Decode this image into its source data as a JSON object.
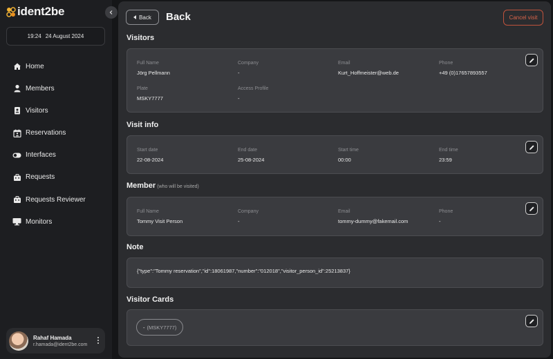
{
  "app": {
    "logo_text": "ident2be"
  },
  "sidebar": {
    "datetime": {
      "time": "19:24",
      "date": "24 August 2024"
    },
    "items": [
      {
        "label": "Home",
        "icon": "home-icon"
      },
      {
        "label": "Members",
        "icon": "person-icon"
      },
      {
        "label": "Visitors",
        "icon": "badge-icon"
      },
      {
        "label": "Reservations",
        "icon": "calendar-person-icon"
      },
      {
        "label": "Interfaces",
        "icon": "toggle-icon"
      },
      {
        "label": "Requests",
        "icon": "briefcase-icon"
      },
      {
        "label": "Requests Reviewer",
        "icon": "briefcase-icon"
      },
      {
        "label": "Monitors",
        "icon": "monitor-icon"
      }
    ],
    "user": {
      "name": "Rahaf Hamada",
      "email": "r.hamada@ident2be.com"
    }
  },
  "header": {
    "back_label": "Back",
    "title": "Back",
    "cancel_label": "Cancel visit"
  },
  "visitors": {
    "title": "Visitors",
    "fields": {
      "full_name": {
        "label": "Full Name",
        "value": "Jörg Pellmann"
      },
      "company": {
        "label": "Company",
        "value": "-"
      },
      "email": {
        "label": "Email",
        "value": "Kurt_Hoffmeister@web.de"
      },
      "phone": {
        "label": "Phone",
        "value": "+49 (0)17657893557"
      },
      "plate": {
        "label": "Plate",
        "value": "MSKY7777"
      },
      "access_profile": {
        "label": "Access Profile",
        "value": "-"
      }
    }
  },
  "visit_info": {
    "title": "Visit info",
    "fields": {
      "start_date": {
        "label": "Start date",
        "value": "22-08-2024"
      },
      "end_date": {
        "label": "End date",
        "value": "25-08-2024"
      },
      "start_time": {
        "label": "Start time",
        "value": "00:00"
      },
      "end_time": {
        "label": "End time",
        "value": "23:59"
      }
    }
  },
  "member": {
    "title": "Member",
    "subtitle": "(who will be visited)",
    "fields": {
      "full_name": {
        "label": "Full Name",
        "value": "Tommy Visit Person"
      },
      "company": {
        "label": "Company",
        "value": "-"
      },
      "email": {
        "label": "Email",
        "value": "tommy-dummy@fakemail.com"
      },
      "phone": {
        "label": "Phone",
        "value": "-"
      }
    }
  },
  "note": {
    "title": "Note",
    "text": "{\"type\":\"Tommy reservation\",\"id\":18061987,\"number\":\"012018\",\"visitor_person_id\":25213837}"
  },
  "visitor_cards": {
    "title": "Visitor Cards",
    "chip_prefix": "-",
    "chip_value": "(MSKY7777)"
  },
  "colors": {
    "accent": "#f2b233",
    "danger": "#d9644a",
    "card_bg": "#3a3b3f"
  }
}
